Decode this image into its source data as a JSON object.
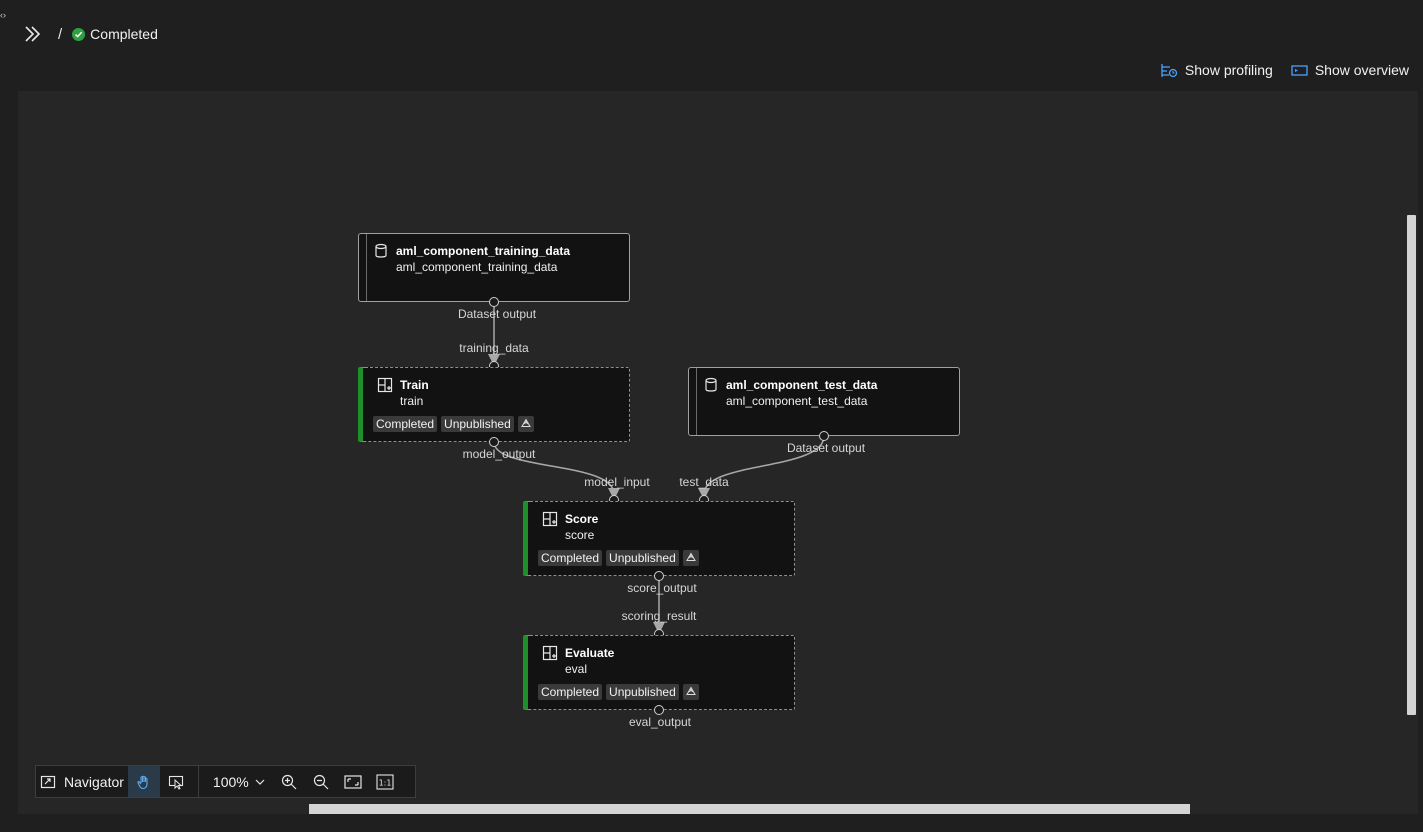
{
  "header": {
    "separator": "/",
    "status_label": "Completed",
    "status_color": "#2ea043"
  },
  "actions": {
    "show_profiling": "Show profiling",
    "show_overview": "Show overview"
  },
  "nodes": {
    "training_data": {
      "title": "aml_component_training_data",
      "subtitle": "aml_component_training_data",
      "icon": "database-icon"
    },
    "test_data": {
      "title": "aml_component_test_data",
      "subtitle": "aml_component_test_data",
      "icon": "database-icon"
    },
    "train": {
      "title": "Train",
      "subtitle": "train",
      "status": "Completed",
      "publish": "Unpublished",
      "icon": "component-icon"
    },
    "score": {
      "title": "Score",
      "subtitle": "score",
      "status": "Completed",
      "publish": "Unpublished",
      "icon": "component-icon"
    },
    "evaluate": {
      "title": "Evaluate",
      "subtitle": "eval",
      "status": "Completed",
      "publish": "Unpublished",
      "icon": "component-icon"
    }
  },
  "ports": {
    "training_data_out": "Dataset output",
    "train_in": "training_data",
    "train_out": "model_output",
    "test_data_out": "Dataset output",
    "score_in_model": "model_input",
    "score_in_test": "test_data",
    "score_out": "score_output",
    "eval_in": "scoring_result",
    "eval_out": "eval_output"
  },
  "toolbar": {
    "navigator_label": "Navigator",
    "zoom_level": "100%",
    "actual_size_label": "1:1"
  },
  "colors": {
    "accent": "#2ea043",
    "component_bar": "#1f8f2a",
    "canvas_bg": "#262626",
    "link_icon": "#4aa3ff"
  }
}
